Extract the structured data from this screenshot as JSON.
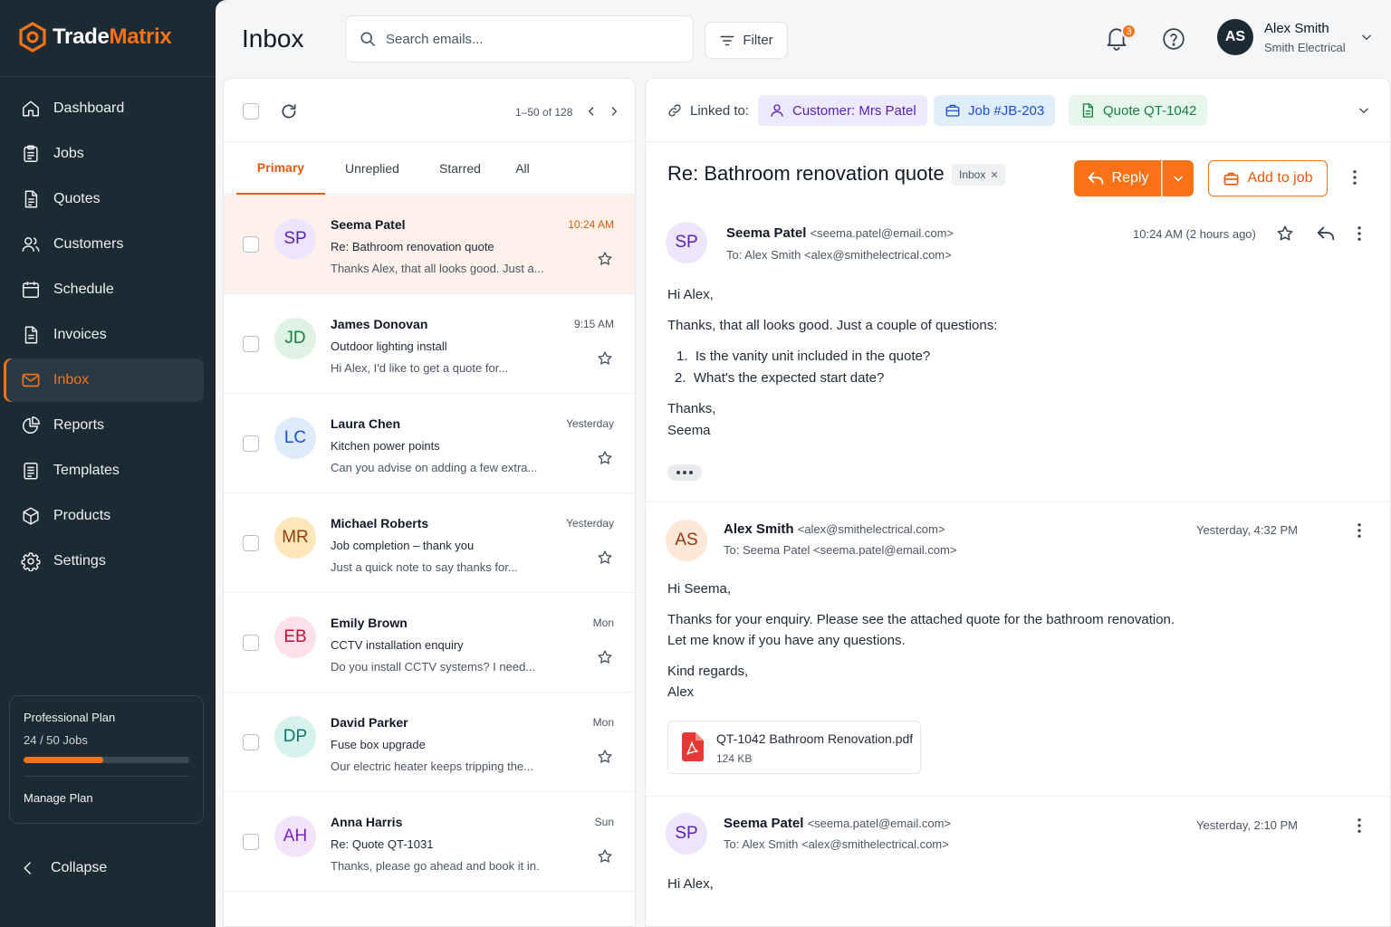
{
  "app": {
    "name_part1": "Trade",
    "name_part2": "Matrix",
    "brand_color": "#f97316"
  },
  "sidebar": {
    "items": [
      {
        "label": "Dashboard",
        "icon": "home-icon"
      },
      {
        "label": "Jobs",
        "icon": "clipboard-icon"
      },
      {
        "label": "Quotes",
        "icon": "document-icon"
      },
      {
        "label": "Customers",
        "icon": "users-icon"
      },
      {
        "label": "Schedule",
        "icon": "calendar-icon"
      },
      {
        "label": "Invoices",
        "icon": "invoice-icon"
      },
      {
        "label": "Inbox",
        "icon": "mail-icon",
        "active": true
      },
      {
        "label": "Reports",
        "icon": "pie-chart-icon"
      },
      {
        "label": "Templates",
        "icon": "template-icon"
      },
      {
        "label": "Products",
        "icon": "box-icon"
      },
      {
        "label": "Settings",
        "icon": "gear-icon"
      }
    ],
    "plan": {
      "title": "Professional Plan",
      "usage": "24 / 50 Jobs",
      "usage_fraction": 0.48,
      "manage": "Manage Plan"
    },
    "collapse": "Collapse"
  },
  "header": {
    "title": "Inbox",
    "search_placeholder": "Search emails...",
    "filter": "Filter",
    "notification_count": "3",
    "user": {
      "initials": "AS",
      "name": "Alex Smith",
      "company": "Smith Electrical"
    }
  },
  "list": {
    "pager": "1–50 of 128",
    "tabs": [
      "Primary",
      "Unreplied",
      "Starred",
      "All"
    ],
    "emails": [
      {
        "initials": "SP",
        "sender": "Seema Patel",
        "subject": "Re: Bathroom renovation quote",
        "preview": "Thanks Alex, that all looks good. Just a...",
        "time": "10:24 AM",
        "unread": true,
        "selected": true,
        "avatar_bg": "#ede5fb",
        "avatar_fg": "#5b21b6"
      },
      {
        "initials": "JD",
        "sender": "James Donovan",
        "subject": "Outdoor lighting install",
        "preview": "Hi Alex, I'd like to get a quote for...",
        "time": "9:15 AM",
        "avatar_bg": "#dff3e5",
        "avatar_fg": "#15803d"
      },
      {
        "initials": "LC",
        "sender": "Laura Chen",
        "subject": "Kitchen power points",
        "preview": "Can you advise on adding a few extra...",
        "time": "Yesterday",
        "avatar_bg": "#deebfb",
        "avatar_fg": "#1d4ed8"
      },
      {
        "initials": "MR",
        "sender": "Michael Roberts",
        "subject": "Job completion – thank you",
        "preview": "Just a quick note to say thanks for...",
        "time": "Yesterday",
        "avatar_bg": "#fde7b8",
        "avatar_fg": "#92400e"
      },
      {
        "initials": "EB",
        "sender": "Emily Brown",
        "subject": "CCTV installation enquiry",
        "preview": "Do you install CCTV systems? I need...",
        "time": "Mon",
        "avatar_bg": "#fde0ea",
        "avatar_fg": "#be123c"
      },
      {
        "initials": "DP",
        "sender": "David Parker",
        "subject": "Fuse box upgrade",
        "preview": "Our electric heater keeps tripping the...",
        "time": "Mon",
        "avatar_bg": "#d5f2ec",
        "avatar_fg": "#0f766e"
      },
      {
        "initials": "AH",
        "sender": "Anna Harris",
        "subject": "Re: Quote QT-1031",
        "preview": "Thanks, please go ahead and book it in.",
        "time": "Sun",
        "avatar_bg": "#f3e3fb",
        "avatar_fg": "#7e22ce"
      }
    ]
  },
  "reader": {
    "linked_label": "Linked to:",
    "chips": {
      "customer": "Customer: Mrs Patel",
      "job": "Job #JB-203",
      "quote": "Quote QT-1042"
    },
    "subject": "Re: Bathroom renovation quote",
    "label": "Inbox",
    "reply": "Reply",
    "add_to_job": "Add to job",
    "messages": [
      {
        "initials": "SP",
        "from_name": "Seema Patel",
        "from_email": "<seema.patel@email.com>",
        "to": "To: Alex Smith <alex@smithelectrical.com>",
        "time": "10:24 AM (2 hours ago)",
        "greeting": "Hi Alex,",
        "intro": "Thanks, that all looks good. Just a couple of questions:",
        "list": [
          "Is the vanity unit included in the quote?",
          "What's the expected start date?"
        ],
        "signoff": "Thanks,",
        "signature": "Seema"
      },
      {
        "initials": "AS",
        "from_name": "Alex Smith",
        "from_email": "<alex@smithelectrical.com>",
        "to": "To: Seema Patel <seema.patel@email.com>",
        "time": "Yesterday, 4:32 PM",
        "greeting": "Hi Seema,",
        "line1": "Thanks for your enquiry. Please see the attached quote for the bathroom renovation.",
        "line2": "Let me know if you have any questions.",
        "signoff": "Kind regards,",
        "signature": "Alex",
        "attachment": {
          "name": "QT-1042 Bathroom Renovation.pdf",
          "size": "124 KB",
          "icon": "pdf-icon"
        }
      },
      {
        "initials": "SP",
        "from_name": "Seema Patel",
        "from_email": "<seema.patel@email.com>",
        "to": "To: Alex Smith <alex@smithelectrical.com>",
        "time": "Yesterday, 2:10 PM",
        "greeting": "Hi Alex,"
      }
    ]
  }
}
